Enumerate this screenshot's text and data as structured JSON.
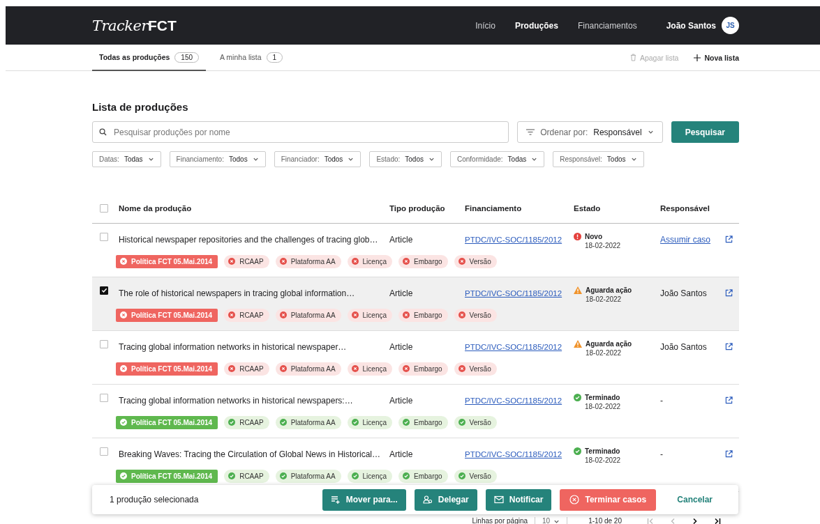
{
  "header": {
    "logo_light": "Tracker",
    "logo_bold": "FCT",
    "nav": [
      {
        "label": "Início",
        "selected": false
      },
      {
        "label": "Produções",
        "selected": true
      },
      {
        "label": "Financiamentos",
        "selected": false
      }
    ],
    "user": {
      "name": "João Santos",
      "initials": "JS"
    }
  },
  "tabs": [
    {
      "label": "Todas as produções",
      "count": "150",
      "selected": true
    },
    {
      "label": "A minha lista",
      "count": "1",
      "selected": false
    }
  ],
  "list_actions": [
    {
      "label": "Apagar lista",
      "kind": "delete",
      "disabled": true
    },
    {
      "label": "Nova lista",
      "kind": "add",
      "disabled": false
    }
  ],
  "title": "Lista de produções",
  "search": {
    "placeholder": "Pesquisar produções por nome"
  },
  "sort": {
    "label": "Ordenar por:",
    "value": "Responsável"
  },
  "search_button": "Pesquisar",
  "filters": [
    {
      "label": "Datas:",
      "value": "Todas"
    },
    {
      "label": "Financiamento:",
      "value": "Todos"
    },
    {
      "label": "Financiador:",
      "value": "Todos"
    },
    {
      "label": "Estado:",
      "value": "Todos"
    },
    {
      "label": "Conformidade:",
      "value": "Todas"
    },
    {
      "label": "Responsável:",
      "value": "Todos"
    }
  ],
  "table": {
    "select_all_checked": false,
    "columns": [
      "Nome da produção",
      "Tipo produção",
      "Financiamento",
      "Estado",
      "Responsável"
    ],
    "rows": [
      {
        "selected": false,
        "name": "Historical newspaper repositories and the challenges of tracing glob…",
        "type": "Article",
        "funding": "PTDC/IVC-SOC/1185/2012",
        "status": {
          "kind": "new",
          "label": "Novo",
          "date": "18-02-2022"
        },
        "responsible": {
          "kind": "link",
          "text": "Assumir caso"
        },
        "tags": [
          {
            "label": "Política FCT 05.Mai.2014",
            "kind": "policy",
            "passed": false
          },
          {
            "label": "RCAAP",
            "kind": "check",
            "passed": false
          },
          {
            "label": "Plataforma AA",
            "kind": "check",
            "passed": false
          },
          {
            "label": "Licença",
            "kind": "check",
            "passed": false
          },
          {
            "label": "Embargo",
            "kind": "check",
            "passed": false
          },
          {
            "label": "Versão",
            "kind": "check",
            "passed": false
          }
        ]
      },
      {
        "selected": true,
        "name": "The role of historical newspapers in tracing global information…",
        "type": "Article",
        "funding": "PTDC/IVC-SOC/1185/2012",
        "status": {
          "kind": "waiting",
          "label": "Aguarda ação",
          "date": "18-02-2022"
        },
        "responsible": {
          "kind": "text",
          "text": "João Santos"
        },
        "tags": [
          {
            "label": "Política FCT 05.Mai.2014",
            "kind": "policy",
            "passed": false
          },
          {
            "label": "RCAAP",
            "kind": "check",
            "passed": false
          },
          {
            "label": "Plataforma AA",
            "kind": "check",
            "passed": false
          },
          {
            "label": "Licença",
            "kind": "check",
            "passed": false
          },
          {
            "label": "Embargo",
            "kind": "check",
            "passed": false
          },
          {
            "label": "Versão",
            "kind": "check",
            "passed": false
          }
        ]
      },
      {
        "selected": false,
        "name": "Tracing global information networks in historical newspaper…",
        "type": "Article",
        "funding": "PTDC/IVC-SOC/1185/2012",
        "status": {
          "kind": "waiting",
          "label": "Aguarda ação",
          "date": "18-02-2022"
        },
        "responsible": {
          "kind": "text",
          "text": "João Santos"
        },
        "tags": [
          {
            "label": "Política FCT 05.Mai.2014",
            "kind": "policy",
            "passed": false
          },
          {
            "label": "RCAAP",
            "kind": "check",
            "passed": false
          },
          {
            "label": "Plataforma AA",
            "kind": "check",
            "passed": false
          },
          {
            "label": "Licença",
            "kind": "check",
            "passed": false
          },
          {
            "label": "Embargo",
            "kind": "check",
            "passed": false
          },
          {
            "label": "Versão",
            "kind": "check",
            "passed": false
          }
        ]
      },
      {
        "selected": false,
        "name": "Tracing global information networks in historical newspapers:…",
        "type": "Article",
        "funding": "PTDC/IVC-SOC/1185/2012",
        "status": {
          "kind": "done",
          "label": "Terminado",
          "date": "18-02-2022"
        },
        "responsible": {
          "kind": "text",
          "text": "-"
        },
        "tags": [
          {
            "label": "Política FCT 05.Mai.2014",
            "kind": "policy",
            "passed": true
          },
          {
            "label": "RCAAP",
            "kind": "check",
            "passed": true
          },
          {
            "label": "Plataforma AA",
            "kind": "check",
            "passed": true
          },
          {
            "label": "Licença",
            "kind": "check",
            "passed": true
          },
          {
            "label": "Embargo",
            "kind": "check",
            "passed": true
          },
          {
            "label": "Versão",
            "kind": "check",
            "passed": true
          }
        ]
      },
      {
        "selected": false,
        "name": "Breaking Waves: Tracing the Circulation of Global News in Historical…",
        "type": "Article",
        "funding": "PTDC/IVC-SOC/1185/2012",
        "status": {
          "kind": "done",
          "label": "Terminado",
          "date": "18-02-2022"
        },
        "responsible": {
          "kind": "text",
          "text": "-"
        },
        "tags": [
          {
            "label": "Política FCT 05.Mai.2014",
            "kind": "policy",
            "passed": true
          },
          {
            "label": "RCAAP",
            "kind": "check",
            "passed": true
          },
          {
            "label": "Plataforma AA",
            "kind": "check",
            "passed": true
          },
          {
            "label": "Licença",
            "kind": "check",
            "passed": true
          },
          {
            "label": "Embargo",
            "kind": "check",
            "passed": true
          },
          {
            "label": "Versão",
            "kind": "check",
            "passed": true
          }
        ]
      }
    ]
  },
  "pagination": {
    "rows_label": "Linhas por página",
    "rows_value": "10",
    "range": "1-10 de 20"
  },
  "action_bar": {
    "summary": "1 produção selecionada",
    "buttons": [
      {
        "label": "Mover para...",
        "kind": "move"
      },
      {
        "label": "Delegar",
        "kind": "delegate"
      },
      {
        "label": "Notificar",
        "kind": "notify"
      },
      {
        "label": "Terminar casos",
        "kind": "finish"
      },
      {
        "label": "Cancelar",
        "kind": "cancel"
      }
    ]
  }
}
